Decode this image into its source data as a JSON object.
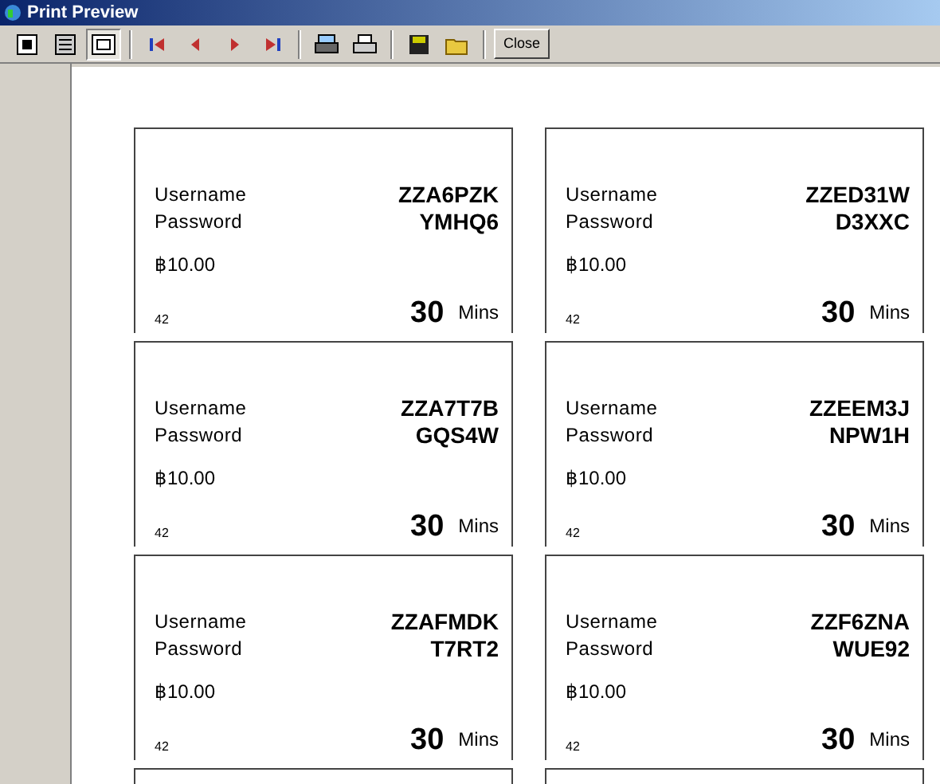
{
  "window": {
    "title": "Print Preview"
  },
  "toolbar": [
    {
      "kind": "one-page",
      "selected": false
    },
    {
      "kind": "multi-page",
      "selected": false
    },
    {
      "kind": "fit",
      "selected": true
    },
    {
      "kind": "sep"
    },
    {
      "kind": "first",
      "selected": false
    },
    {
      "kind": "prev",
      "selected": false
    },
    {
      "kind": "next",
      "selected": false
    },
    {
      "kind": "last",
      "selected": false
    },
    {
      "kind": "sep"
    },
    {
      "kind": "print-setup",
      "selected": false
    },
    {
      "kind": "print",
      "selected": false
    },
    {
      "kind": "sep"
    },
    {
      "kind": "save",
      "selected": false
    },
    {
      "kind": "open",
      "selected": false
    },
    {
      "kind": "sep"
    },
    {
      "kind": "close",
      "label": "Close"
    }
  ],
  "tickets": [
    {
      "username_label": "Username",
      "password_label": "Password",
      "username": "ZZA6PZK",
      "password": "YMHQ6",
      "price": "฿10.00",
      "number": "42",
      "duration": "30",
      "unit": "Mins"
    },
    {
      "username_label": "Username",
      "password_label": "Password",
      "username": "ZZED31W",
      "password": "D3XXC",
      "price": "฿10.00",
      "number": "42",
      "duration": "30",
      "unit": "Mins"
    },
    {
      "username_label": "Username",
      "password_label": "Password",
      "username": "ZZA7T7B",
      "password": "GQS4W",
      "price": "฿10.00",
      "number": "42",
      "duration": "30",
      "unit": "Mins"
    },
    {
      "username_label": "Username",
      "password_label": "Password",
      "username": "ZZEEM3J",
      "password": "NPW1H",
      "price": "฿10.00",
      "number": "42",
      "duration": "30",
      "unit": "Mins"
    },
    {
      "username_label": "Username",
      "password_label": "Password",
      "username": "ZZAFMDK",
      "password": "T7RT2",
      "price": "฿10.00",
      "number": "42",
      "duration": "30",
      "unit": "Mins"
    },
    {
      "username_label": "Username",
      "password_label": "Password",
      "username": "ZZF6ZNA",
      "password": "WUE92",
      "price": "฿10.00",
      "number": "42",
      "duration": "30",
      "unit": "Mins"
    }
  ]
}
